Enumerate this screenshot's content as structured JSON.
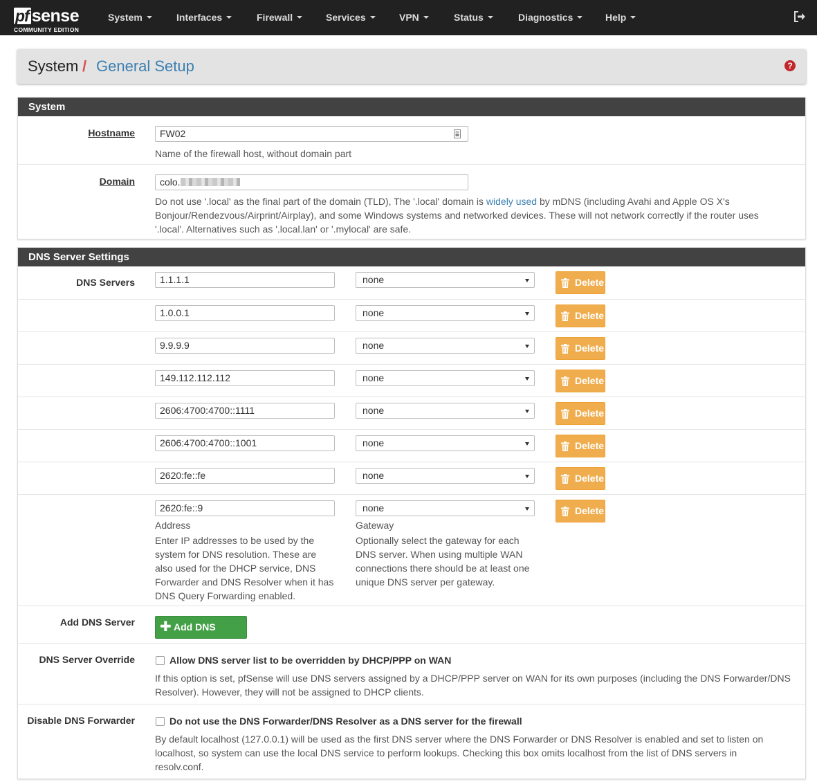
{
  "brand": {
    "name_pf": "pf",
    "name_sense": "sense",
    "edition": "COMMUNITY EDITION"
  },
  "nav": {
    "items": [
      "System",
      "Interfaces",
      "Firewall",
      "Services",
      "VPN",
      "Status",
      "Diagnostics",
      "Help"
    ]
  },
  "header": {
    "section": "System",
    "separator": "/",
    "current": "General Setup"
  },
  "system_panel": {
    "title": "System",
    "hostname_label": "Hostname",
    "hostname_value": "FW02",
    "hostname_help": "Name of the firewall host, without domain part",
    "domain_label": "Domain",
    "domain_value_visible": "colo.",
    "domain_help_1": "Do not use '.local' as the final part of the domain (TLD), The '.local' domain is ",
    "domain_help_link": "widely used",
    "domain_help_2": " by mDNS (including Avahi and Apple OS X's Bonjour/Rendezvous/Airprint/Airplay), and some Windows systems and networked devices. These will not network correctly if the router uses '.local'. Alternatives such as '.local.lan' or '.mylocal' are safe."
  },
  "dns_panel": {
    "title": "DNS Server Settings",
    "servers_label": "DNS Servers",
    "delete_label": "Delete",
    "servers": [
      {
        "address": "1.1.1.1",
        "gateway": "none"
      },
      {
        "address": "1.0.0.1",
        "gateway": "none"
      },
      {
        "address": "9.9.9.9",
        "gateway": "none"
      },
      {
        "address": "149.112.112.112",
        "gateway": "none"
      },
      {
        "address": "2606:4700:4700::1111",
        "gateway": "none"
      },
      {
        "address": "2606:4700:4700::1001",
        "gateway": "none"
      },
      {
        "address": "2620:fe::fe",
        "gateway": "none"
      },
      {
        "address": "2620:fe::9",
        "gateway": "none"
      }
    ],
    "address_col_label": "Address",
    "address_help": "Enter IP addresses to be used by the system for DNS resolution. These are also used for the DHCP service, DNS Forwarder and DNS Resolver when it has DNS Query Forwarding enabled.",
    "gateway_col_label": "Gateway",
    "gateway_help": "Optionally select the gateway for each DNS server. When using multiple WAN connections there should be at least one unique DNS server per gateway.",
    "add_label": "Add DNS Server",
    "add_button": "Add DNS Server",
    "override_label": "DNS Server Override",
    "override_checkbox": "Allow DNS server list to be overridden by DHCP/PPP on WAN",
    "override_help": "If this option is set, pfSense will use DNS servers assigned by a DHCP/PPP server on WAN for its own purposes (including the DNS Forwarder/DNS Resolver). However, they will not be assigned to DHCP clients.",
    "disable_fwd_label": "Disable DNS Forwarder",
    "disable_fwd_checkbox": "Do not use the DNS Forwarder/DNS Resolver as a DNS server for the firewall",
    "disable_fwd_help": "By default localhost (127.0.0.1) will be used as the first DNS server where the DNS Forwarder or DNS Resolver is enabled and set to listen on localhost, so system can use the local DNS service to perform lookups. Checking this box omits localhost from the list of DNS servers in resolv.conf."
  },
  "colors": {
    "navbar": "#212121",
    "panel_heading": "#424242",
    "link": "#3c7fb1",
    "delete_button": "#f0ad4e",
    "add_button": "#43a047",
    "help_icon": "#c0282d"
  }
}
